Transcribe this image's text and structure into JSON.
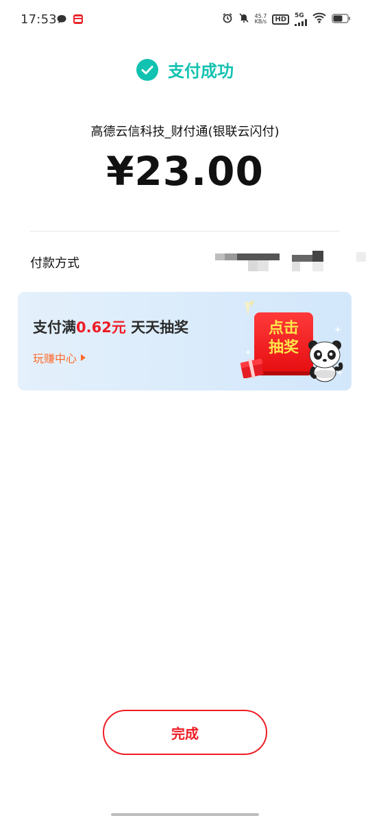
{
  "status_bar": {
    "time": "17:53",
    "net_speed_value": "45.7",
    "net_speed_unit": "KB/s",
    "hd_label": "HD",
    "network_label": "5G",
    "icons": [
      "message-bubble-icon",
      "app-notification-icon",
      "alarm-icon",
      "mute-icon",
      "signal-icon",
      "wifi-icon",
      "battery-icon"
    ]
  },
  "header": {
    "success_title": "支付成功",
    "check_icon": "check-circle-icon",
    "accent_color": "#12c2b0"
  },
  "payment": {
    "merchant": "高德云信科技_财付通(银联云闪付)",
    "amount": "¥23.00",
    "method_label": "付款方式"
  },
  "promo": {
    "title_prefix": "支付满",
    "title_highlight": "0.62元",
    "title_suffix": " 天天抽奖",
    "link_label": "玩赚中心",
    "lottery_line1": "点击",
    "lottery_line2": "抽奖",
    "highlight_color": "#ee1c25",
    "link_color": "#ff6a2a"
  },
  "actions": {
    "done_label": "完成",
    "button_color": "#ee1c25"
  }
}
